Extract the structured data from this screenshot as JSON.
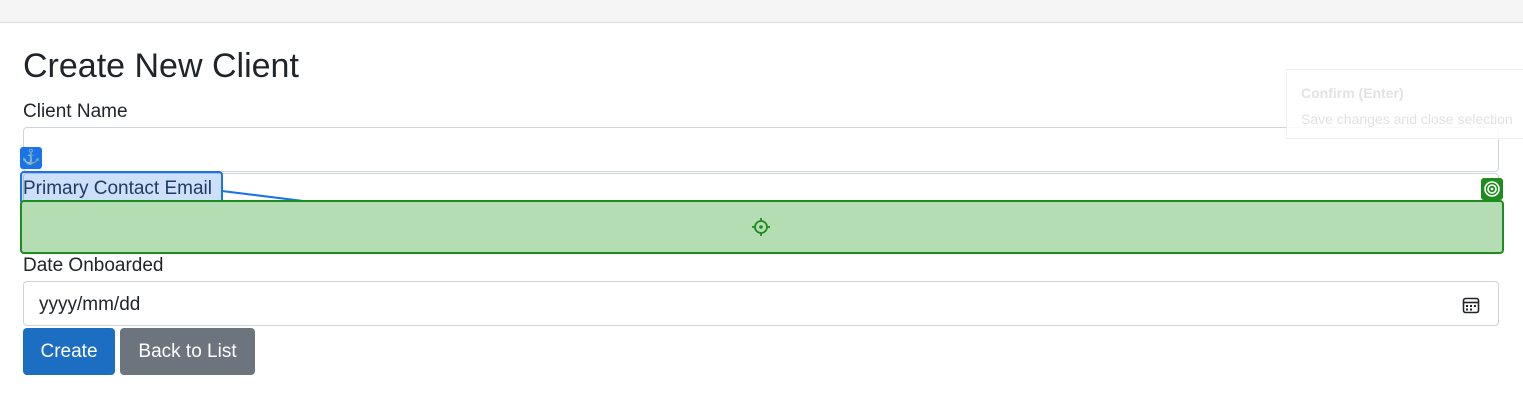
{
  "page": {
    "title": "Create New Client"
  },
  "form": {
    "client_name": {
      "label": "Client Name",
      "value": ""
    },
    "email": {
      "label": "Primary Contact Email",
      "value": ""
    },
    "date": {
      "label": "Date Onboarded",
      "placeholder": "yyyy/mm/dd"
    },
    "create_label": "Create",
    "back_label": "Back to List"
  },
  "tooltip": {
    "title": "Confirm (Enter)",
    "description": "Save changes and close selection"
  },
  "icons": {
    "anchor": "anchor-icon",
    "crosshair": "crosshair-icon",
    "target": "target-icon",
    "calendar": "calendar-icon"
  },
  "colors": {
    "primary": "#1b6ec2",
    "secondary": "#6c757d",
    "anchor_overlay": "#1a73e8",
    "target_overlay": "#1e8c1e",
    "target_fill": "#b4ddb4"
  }
}
